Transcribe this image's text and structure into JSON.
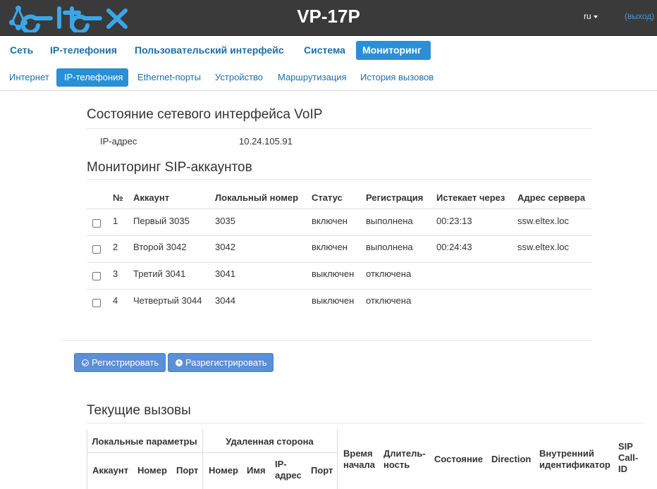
{
  "header": {
    "logo_text": "ELTEX",
    "product": "VP-17P",
    "lang": "ru",
    "logout": "(выход)"
  },
  "nav_main": [
    {
      "label": "Сеть",
      "active": false
    },
    {
      "label": "IP-телефония",
      "active": false
    },
    {
      "label": "Пользовательский интерфейс",
      "active": false
    },
    {
      "label": "Система",
      "active": false
    },
    {
      "label": "Мониторинг",
      "active": true
    }
  ],
  "nav_sub": [
    {
      "label": "Интернет",
      "active": false
    },
    {
      "label": "IP-телефония",
      "active": true
    },
    {
      "label": "Ethernet-порты",
      "active": false
    },
    {
      "label": "Устройство",
      "active": false
    },
    {
      "label": "Маршрутизация",
      "active": false
    },
    {
      "label": "История вызовов",
      "active": false
    }
  ],
  "voip_status": {
    "title": "Состояние сетевого интерфейса VoIP",
    "ip_label": "IP-адрес",
    "ip_value": "10.24.105.91"
  },
  "sip_monitor": {
    "title": "Мониторинг SIP-аккаунтов",
    "columns": [
      "№",
      "Аккаунт",
      "Локальный номер",
      "Статус",
      "Регистрация",
      "Истекает через",
      "Адрес сервера"
    ],
    "rows": [
      {
        "num": "1",
        "account": "Первый 3035",
        "local": "3035",
        "status": "включен",
        "reg": "выполнена",
        "expires": "00:23:13",
        "server": "ssw.eltex.loc"
      },
      {
        "num": "2",
        "account": "Второй 3042",
        "local": "3042",
        "status": "включен",
        "reg": "выполнена",
        "expires": "00:24:43",
        "server": "ssw.eltex.loc"
      },
      {
        "num": "3",
        "account": "Третий 3041",
        "local": "3041",
        "status": "выключен",
        "reg": "отключена",
        "expires": "",
        "server": ""
      },
      {
        "num": "4",
        "account": "Четвертый 3044",
        "local": "3044",
        "status": "выключен",
        "reg": "отключена",
        "expires": "",
        "server": ""
      }
    ]
  },
  "buttons": {
    "register": "Регистрировать",
    "unregister": "Разрегистрировать"
  },
  "calls": {
    "title": "Текущие вызовы",
    "group_local": "Локальные параметры",
    "group_remote": "Удаленная сторона",
    "local_cols": [
      "Аккаунт",
      "Номер",
      "Порт"
    ],
    "remote_cols": [
      "Номер",
      "Имя",
      "IP-адрес",
      "Порт"
    ],
    "start": "Время начала",
    "duration": "Длитель-ность",
    "state": "Состояние",
    "direction": "Direction",
    "internal_id": "Внутренний идентификатор",
    "sip_call_id": "SIP Call-ID"
  }
}
